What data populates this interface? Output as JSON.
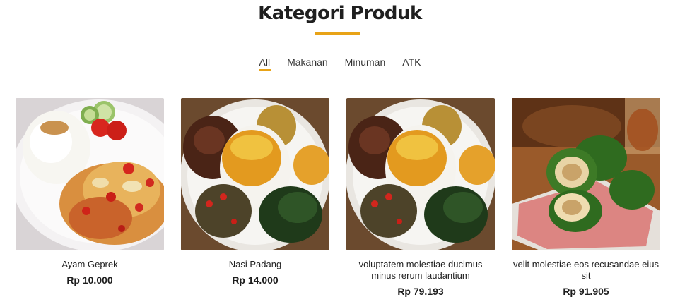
{
  "section": {
    "title": "Kategori Produk"
  },
  "filters": [
    {
      "label": "All",
      "active": true
    },
    {
      "label": "Makanan",
      "active": false
    },
    {
      "label": "Minuman",
      "active": false
    },
    {
      "label": "ATK",
      "active": false
    }
  ],
  "products": [
    {
      "name": "Ayam Geprek",
      "price": "Rp 10.000",
      "image": "ayam-geprek-photo"
    },
    {
      "name": "Nasi Padang",
      "price": "Rp 14.000",
      "image": "nasi-padang-photo"
    },
    {
      "name": "voluptatem molestiae ducimus minus rerum laudantium",
      "price": "Rp 79.193",
      "image": "nasi-padang-photo"
    },
    {
      "name": "velit molestiae eos recusandae eius sit",
      "price": "Rp 91.905",
      "image": "lemper-photo"
    }
  ],
  "colors": {
    "accent": "#e8a317",
    "text": "#222222",
    "background": "#ffffff"
  }
}
